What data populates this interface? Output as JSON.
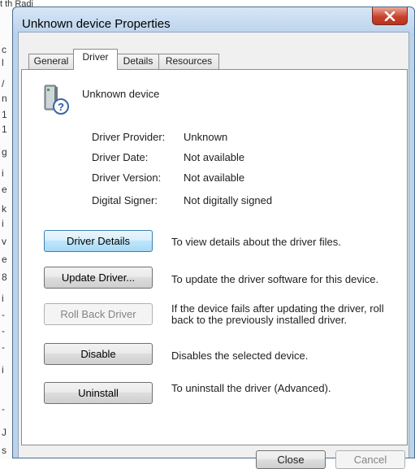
{
  "background": {
    "top_text": "t  th Radi",
    "chars": [
      "c",
      "l",
      "/",
      "n",
      "1",
      "1",
      "g",
      "i",
      "e",
      "k",
      "i",
      "v",
      "e",
      "8",
      "i",
      "-",
      "-",
      "-",
      "i",
      "-",
      "J",
      "s"
    ]
  },
  "window": {
    "title": "Unknown device Properties",
    "close_icon": "close-x-icon"
  },
  "tabs": [
    {
      "label": "General"
    },
    {
      "label": "Driver"
    },
    {
      "label": "Details"
    },
    {
      "label": "Resources"
    }
  ],
  "device": {
    "name": "Unknown device",
    "icon": "unknown-device-icon"
  },
  "properties": [
    {
      "label": "Driver Provider:",
      "value": "Unknown"
    },
    {
      "label": "Driver Date:",
      "value": "Not available"
    },
    {
      "label": "Driver Version:",
      "value": "Not available"
    },
    {
      "label": "Digital Signer:",
      "value": "Not digitally signed"
    }
  ],
  "actions": [
    {
      "button": "Driver Details",
      "description": "To view details about the driver files."
    },
    {
      "button": "Update Driver...",
      "description": "To update the driver software for this device."
    },
    {
      "button": "Roll Back Driver",
      "description_line1": "If the device fails after updating the driver, roll",
      "description_line2": "back to the previously installed driver."
    },
    {
      "button": "Disable",
      "description": "Disables the selected device."
    },
    {
      "button": "Uninstall",
      "description": "To uninstall the driver (Advanced)."
    }
  ],
  "footer": {
    "close": "Close",
    "cancel": "Cancel"
  }
}
